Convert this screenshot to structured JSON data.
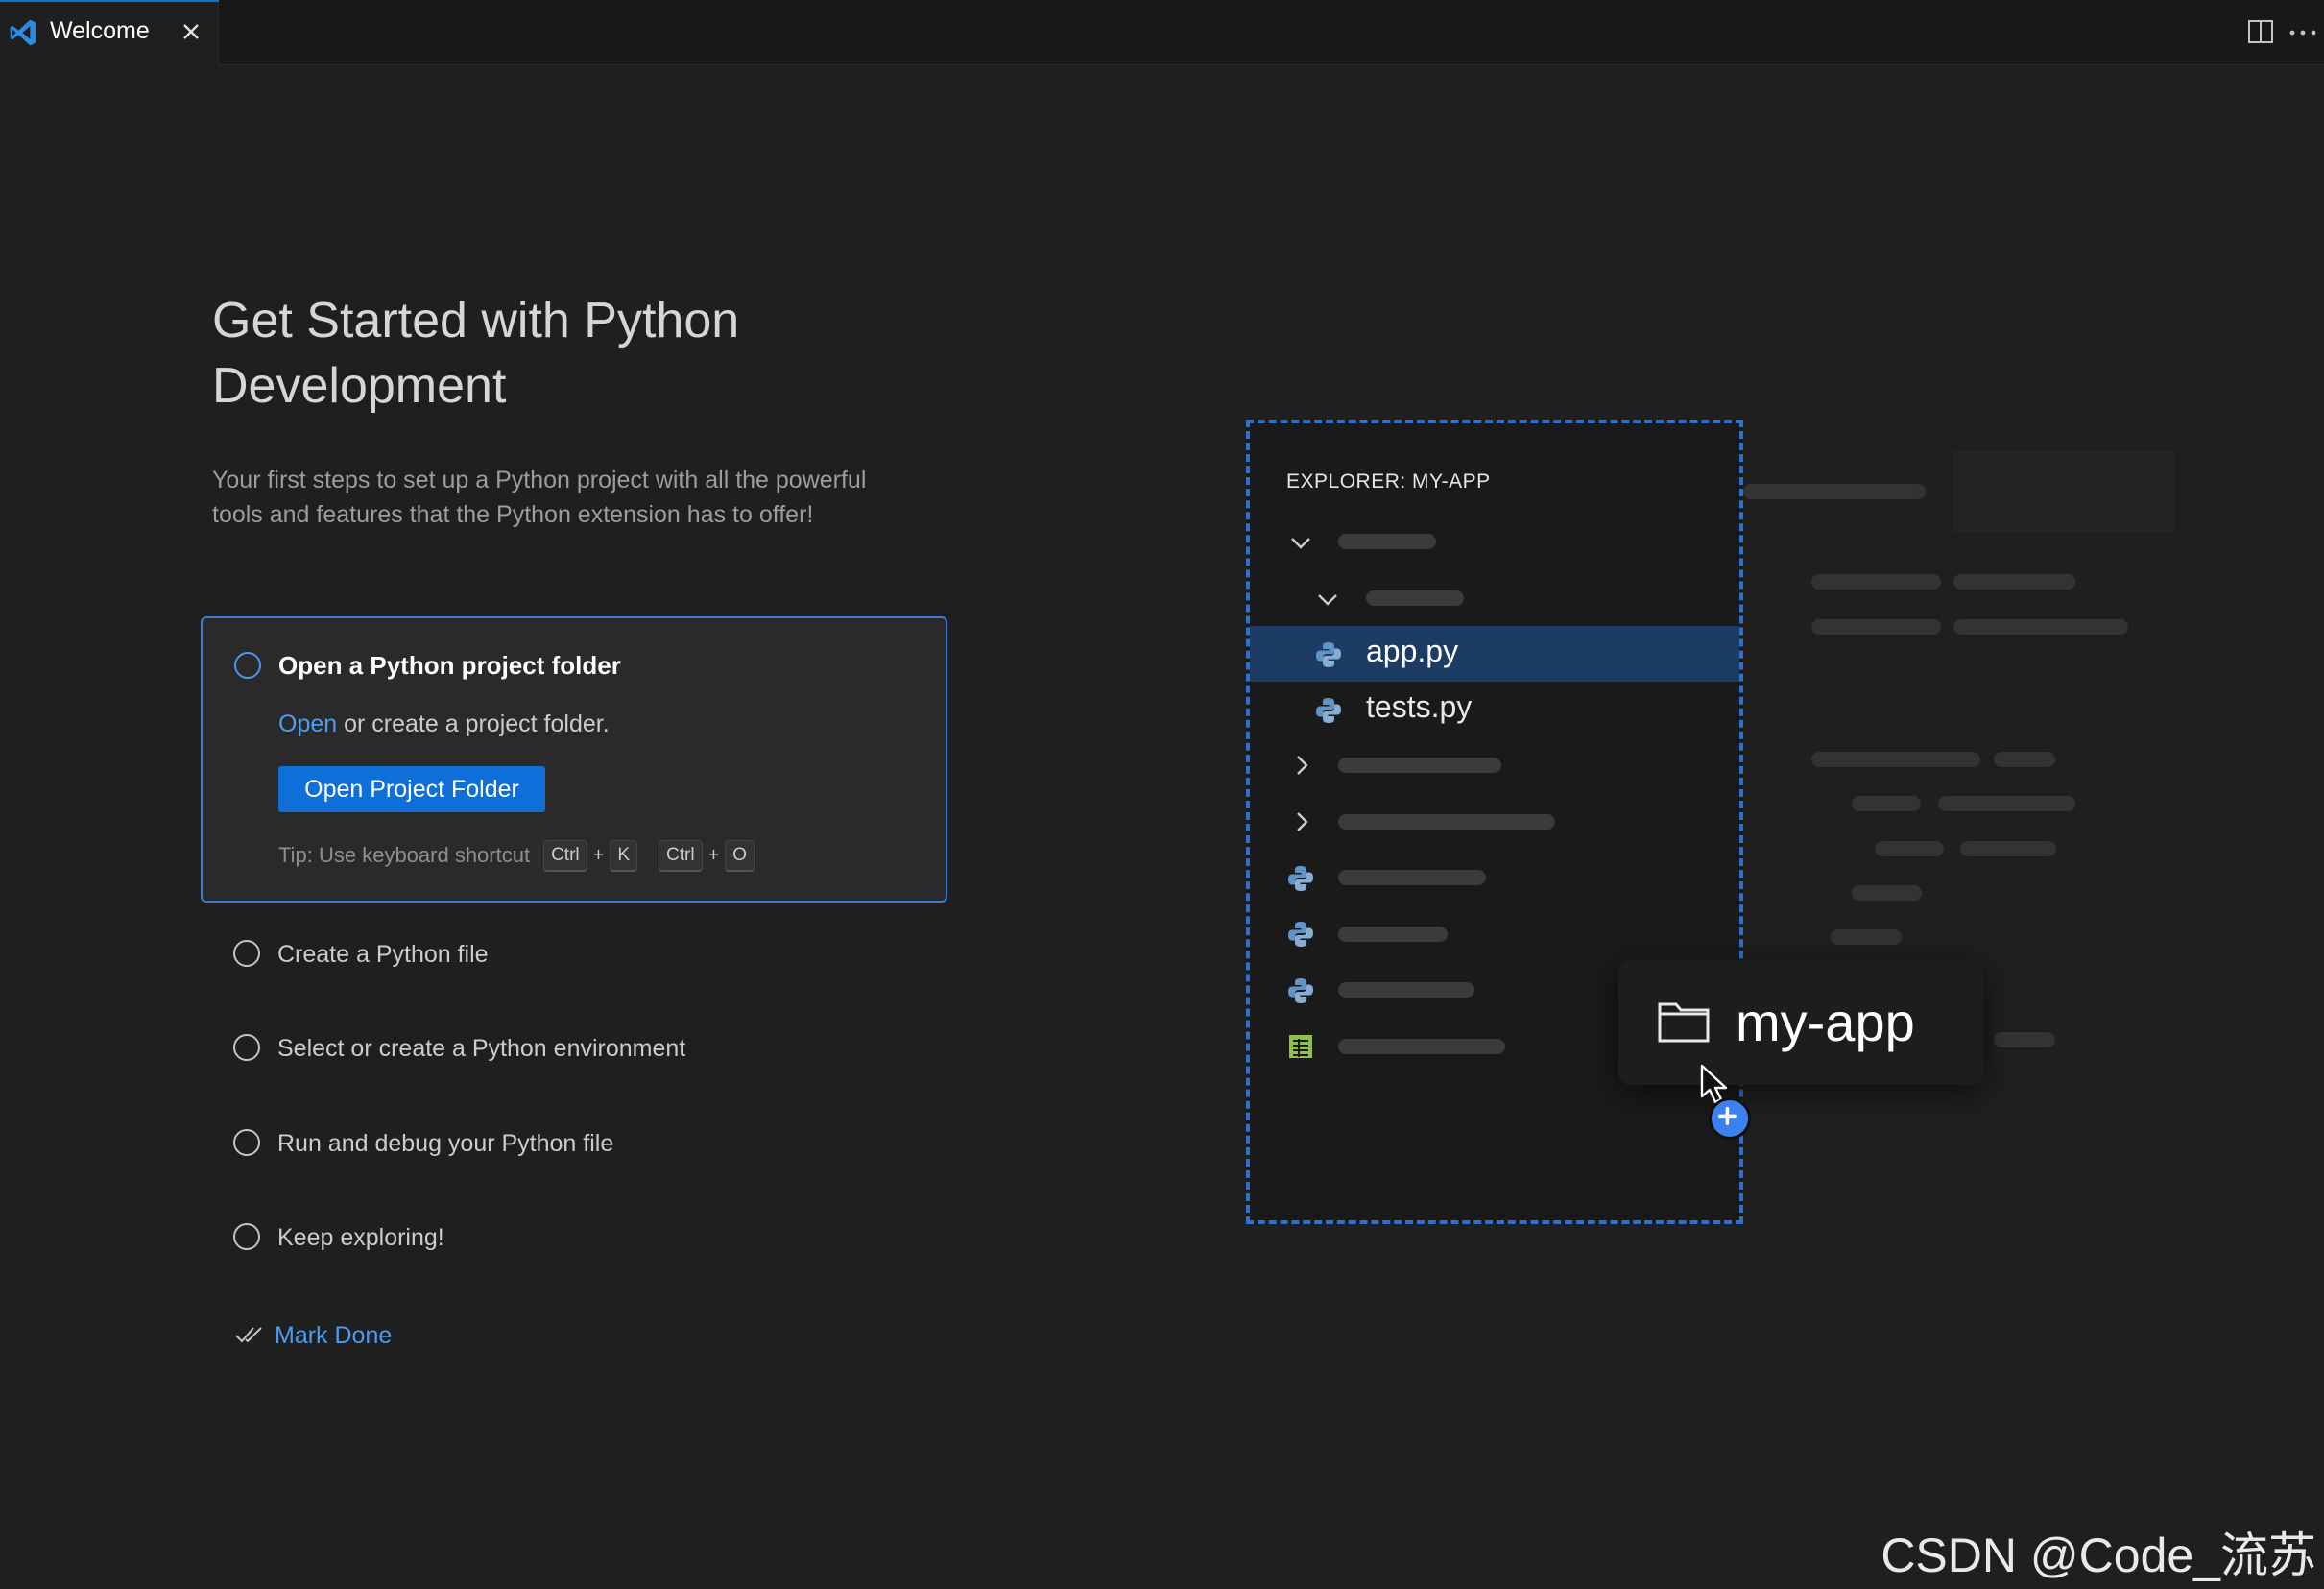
{
  "tabs": [
    {
      "label": "Welcome",
      "icon": "vscode-icon",
      "active": true
    }
  ],
  "walkthrough": {
    "title_line1": "Get Started with Python",
    "title_line2": "Development",
    "subtitle_line1": "Your first steps to set up a Python project with all the powerful",
    "subtitle_line2": "tools and features that the Python extension has to offer!",
    "active_step": {
      "title": "Open a Python project folder",
      "desc_link": "Open",
      "desc_rest": " or create a project folder.",
      "button_label": "Open Project Folder",
      "tip_label": "Tip: Use keyboard shortcut",
      "shortcut": [
        "Ctrl",
        "+",
        "K",
        "Ctrl",
        "+",
        "O"
      ]
    },
    "steps": [
      "Create a Python file",
      "Select or create a Python environment",
      "Run and debug your Python file",
      "Keep exploring!"
    ],
    "mark_done": "Mark Done"
  },
  "illustration": {
    "explorer_title": "EXPLORER: MY-APP",
    "files": [
      "app.py",
      "tests.py"
    ],
    "drag_folder": "my-app"
  },
  "watermark": "CSDN @Code_流苏",
  "colors": {
    "accent": "#0e6fd8",
    "link": "#4d9cf0",
    "focus_border": "#3e7cd6",
    "selection": "#1d3c64"
  }
}
